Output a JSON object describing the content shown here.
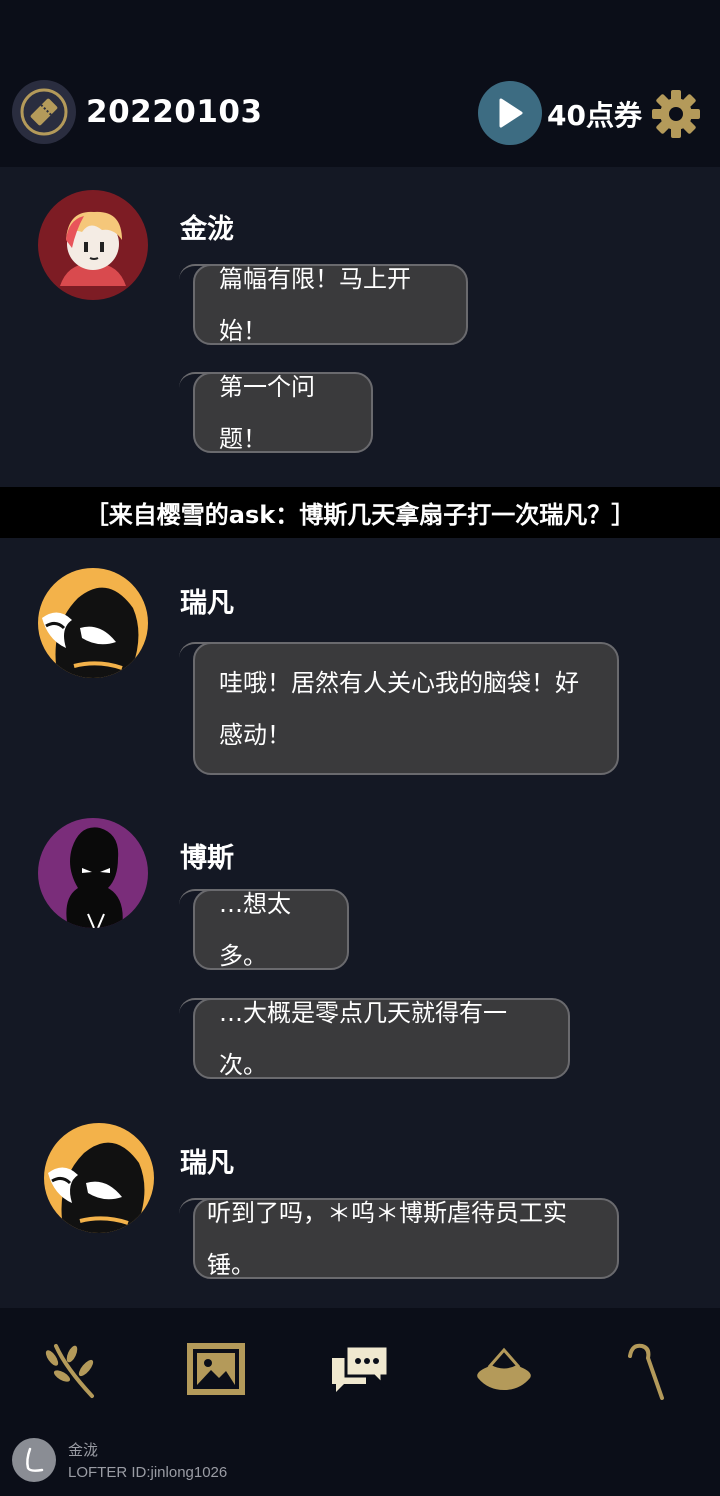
{
  "header": {
    "date": "20220103",
    "points": "40点券"
  },
  "messages": [
    {
      "speaker": "金泷",
      "bubbles": [
        "篇幅有限！马上开始！",
        "第一个问题！"
      ]
    },
    {
      "speaker": "瑞凡",
      "bubbles": [
        "哇哦！居然有人关心我的脑袋！好感动！"
      ]
    },
    {
      "speaker": "博斯",
      "bubbles": [
        "…想太多。",
        "…大概是零点几天就得有一次。"
      ]
    },
    {
      "speaker": "瑞凡",
      "bubbles": [
        "听到了吗，＊呜＊博斯虐待员工实锤。"
      ]
    }
  ],
  "question": "［来自樱雪的ask：博斯几天拿扇子打一次瑞凡？］",
  "nav": {
    "items": [
      "branch-icon",
      "gallery-icon",
      "chat-icon",
      "hat-icon",
      "cane-icon"
    ],
    "active": "chat-icon"
  },
  "watermark": {
    "name": "金泷",
    "id": "LOFTER ID:jinlong1026"
  },
  "colors": {
    "accent": "#b49a5a",
    "play": "#3d6c82",
    "bubble": "#3a3a3c",
    "background": "#141824",
    "bar": "#0b0e18"
  }
}
